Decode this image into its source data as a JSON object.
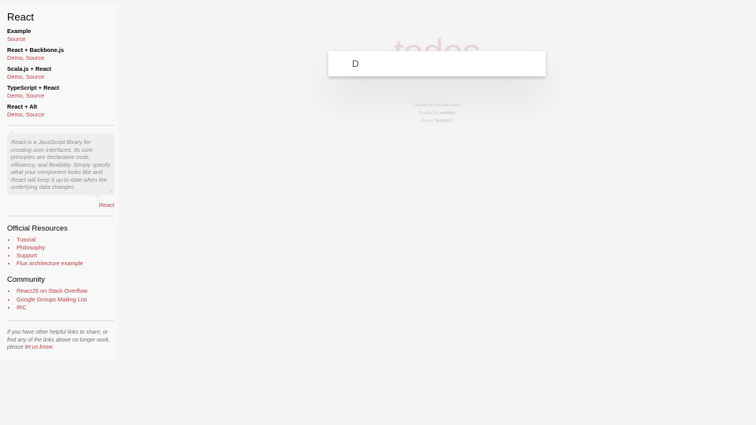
{
  "sidebar": {
    "title": "React",
    "examples": [
      {
        "name": "Example",
        "links": [
          "Source"
        ]
      },
      {
        "name": "React + Backbone.js",
        "links": [
          "Demo",
          "Source"
        ]
      },
      {
        "name": "Scala.js + React",
        "links": [
          "Demo",
          "Source"
        ]
      },
      {
        "name": "TypeScript + React",
        "links": [
          "Demo",
          "Source"
        ]
      },
      {
        "name": "React + Alt",
        "links": [
          "Demo",
          "Source"
        ]
      }
    ],
    "quote": {
      "text": "React is a JavaScript library for creating user interfaces. Its core principles are declarative code, efficiency, and flexibility. Simply specify what your component looks like and React will keep it up-to-date when the underlying data changes.",
      "source": "React"
    },
    "official_resources": {
      "title": "Official Resources",
      "items": [
        "Tutorial",
        "Philosophy",
        "Support",
        "Flux architecture example"
      ]
    },
    "community": {
      "title": "Community",
      "items": [
        "ReactJS on Stack Overflow",
        "Google Groups Mailing List",
        "IRC"
      ]
    },
    "footer": {
      "text": "If you have other helpful links to share, or find any of the links above no longer work, please",
      "link": "let us know."
    }
  },
  "app": {
    "title": "todos",
    "new_todo_value": "D",
    "info": {
      "line1": "Double-click to edit a todo",
      "line2_prefix": "Created by",
      "line2_name": "petehunt",
      "line3_prefix": "Part of",
      "line3_name": "TodoMVC"
    }
  },
  "colors": {
    "accent": "#b83f45",
    "title": "#af2f2f",
    "background": "#f5f5f5"
  }
}
